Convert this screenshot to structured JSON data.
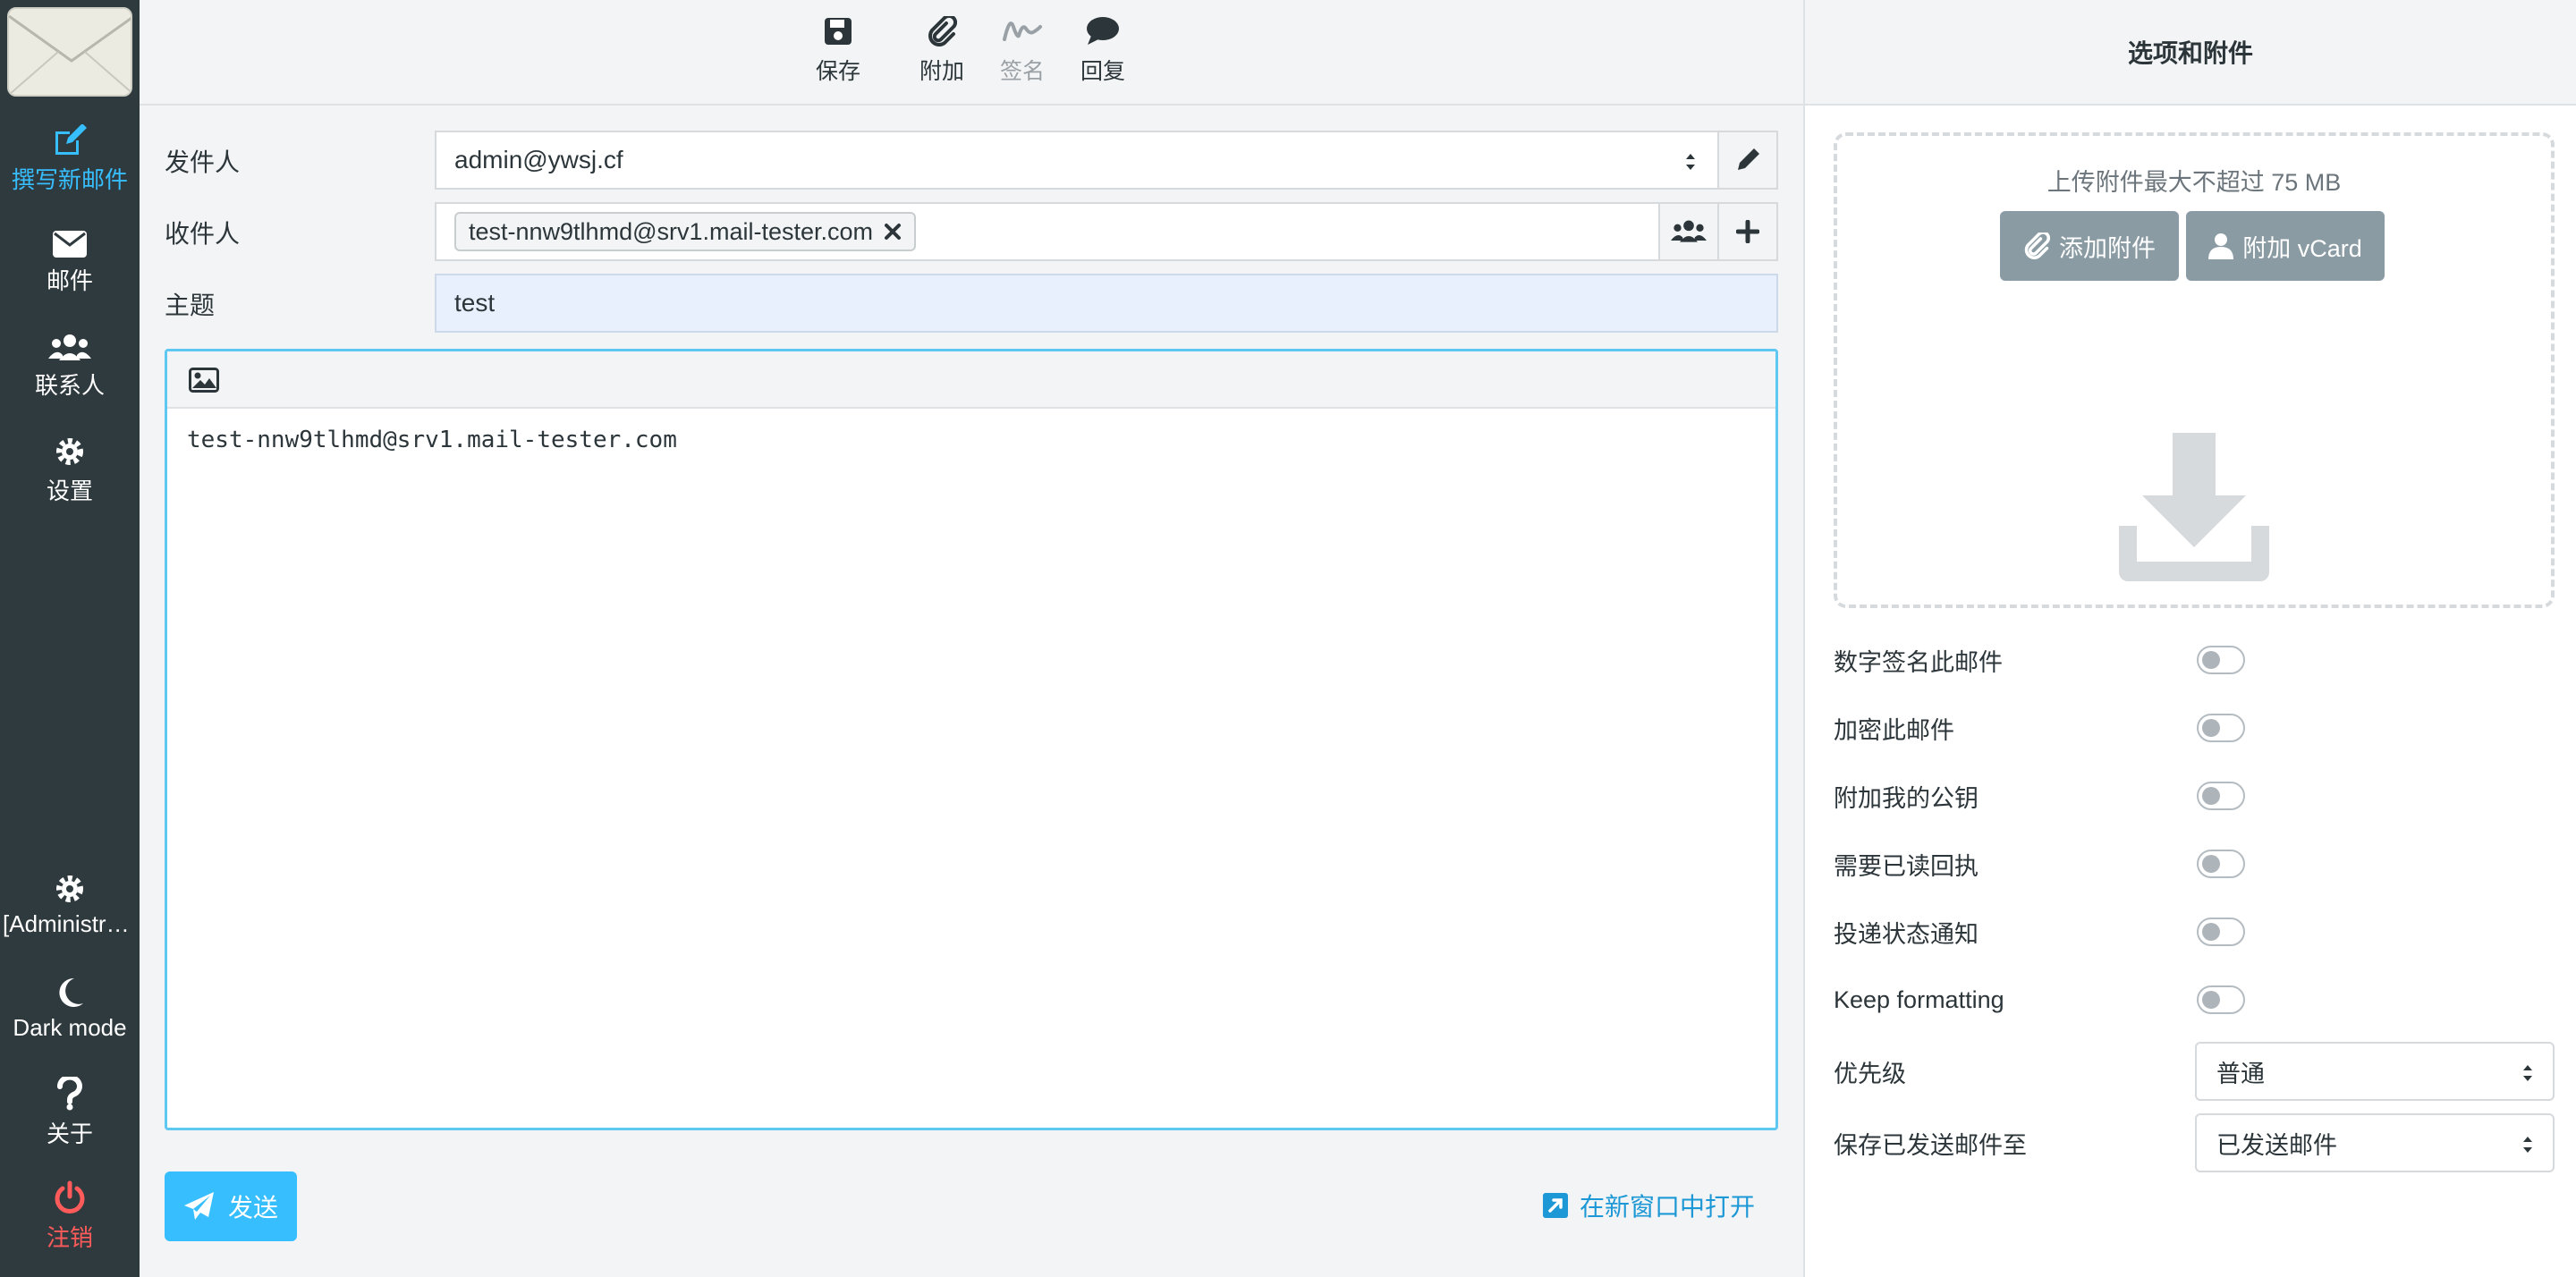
{
  "sidebar": {
    "items": [
      {
        "label": "撰写新邮件",
        "icon": "compose-icon"
      },
      {
        "label": "邮件",
        "icon": "envelope-icon"
      },
      {
        "label": "联系人",
        "icon": "users-icon"
      },
      {
        "label": "设置",
        "icon": "gear-icon"
      }
    ],
    "bottom_items": [
      {
        "label": "[Administra...",
        "icon": "gear-icon"
      },
      {
        "label": "Dark mode",
        "icon": "moon-icon"
      },
      {
        "label": "关于",
        "icon": "question-icon"
      },
      {
        "label": "注销",
        "icon": "power-icon"
      }
    ],
    "colors": {
      "active": "#37beff",
      "logout": "#ff5b5b",
      "background": "#2f3a3f"
    }
  },
  "toolbar": {
    "save": "保存",
    "attach": "附加",
    "signature": "签名",
    "responses": "回复"
  },
  "compose": {
    "from_label": "发件人",
    "from_value": "admin@ywsj.cf",
    "to_label": "收件人",
    "to_recipient": "test-nnw9tlhmd@srv1.mail-tester.com",
    "subject_label": "主题",
    "subject_value": "test",
    "body": "test-nnw9tlhmd@srv1.mail-tester.com",
    "send": "发送",
    "open_new_window": "在新窗口中打开"
  },
  "options": {
    "title": "选项和附件",
    "upload_hint": "上传附件最大不超过 75 MB",
    "add_attachment": "添加附件",
    "attach_vcard": "附加 vCard",
    "toggles": [
      {
        "label": "数字签名此邮件",
        "on": false
      },
      {
        "label": "加密此邮件",
        "on": false
      },
      {
        "label": "附加我的公钥",
        "on": false
      },
      {
        "label": "需要已读回执",
        "on": false
      },
      {
        "label": "投递状态通知",
        "on": false
      },
      {
        "label": "Keep formatting",
        "on": false
      }
    ],
    "priority_label": "优先级",
    "priority_value": "普通",
    "save_sent_label": "保存已发送邮件至",
    "save_sent_value": "已发送邮件"
  }
}
